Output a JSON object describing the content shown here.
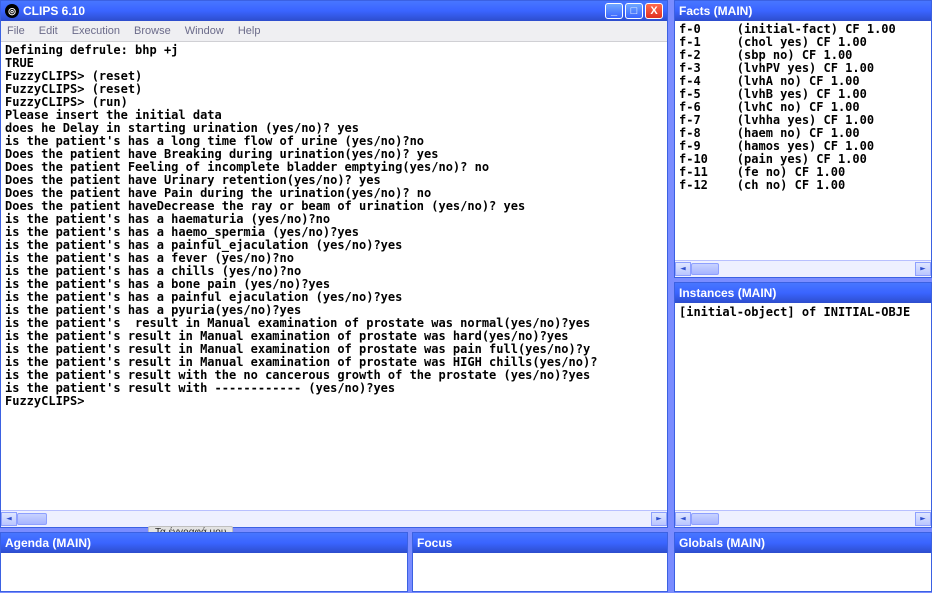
{
  "main": {
    "title": "CLIPS 6.10",
    "menu": [
      "File",
      "Edit",
      "Execution",
      "Browse",
      "Window",
      "Help"
    ],
    "terminal_lines": [
      "Defining defrule: bhp +j",
      "TRUE",
      "FuzzyCLIPS> (reset)",
      "FuzzyCLIPS> (reset)",
      "FuzzyCLIPS> (run)",
      "Please insert the initial data",
      "does he Delay in starting urination (yes/no)? yes",
      "is the patient's has a long time flow of urine (yes/no)?no",
      "Does the patient have Breaking during urination(yes/no)? yes",
      "Does the patient Feeling of incomplete bladder emptying(yes/no)? no",
      "Does the patient have Urinary retention(yes/no)? yes",
      "Does the patient have Pain during the urination(yes/no)? no",
      "Does the patient haveDecrease the ray or beam of urination (yes/no)? yes",
      "is the patient's has a haematuria (yes/no)?no",
      "is the patient's has a haemo_spermia (yes/no)?yes",
      "is the patient's has a painful_ejaculation (yes/no)?yes",
      "is the patient's has a fever (yes/no)?no",
      "is the patient's has a chills (yes/no)?no",
      "is the patient's has a bone pain (yes/no)?yes",
      "is the patient's has a painful ejaculation (yes/no)?yes",
      "is the patient's has a pyuria(yes/no)?yes",
      "is the patient's  result in Manual examination of prostate was normal(yes/no)?yes",
      "is the patient's result in Manual examination of prostate was hard(yes/no)?yes",
      "is the patient's result in Manual examination of prostate was pain full(yes/no)?y",
      "is the patient's result in Manual examination of prostate was HIGH chills(yes/no)?",
      "is the patient's result with the no cancerous growth of the prostate (yes/no)?yes",
      "is the patient's result with ------------ (yes/no)?yes",
      "FuzzyCLIPS>"
    ]
  },
  "facts": {
    "title": "Facts (MAIN)",
    "rows": [
      {
        "id": "f-0",
        "fact": "(initial-fact) CF 1.00"
      },
      {
        "id": "f-1",
        "fact": "(chol yes) CF 1.00"
      },
      {
        "id": "f-2",
        "fact": "(sbp no) CF 1.00"
      },
      {
        "id": "f-3",
        "fact": "(lvhPV yes) CF 1.00"
      },
      {
        "id": "f-4",
        "fact": "(lvhA no) CF 1.00"
      },
      {
        "id": "f-5",
        "fact": "(lvhB yes) CF 1.00"
      },
      {
        "id": "f-6",
        "fact": "(lvhC no) CF 1.00"
      },
      {
        "id": "f-7",
        "fact": "(lvhha yes) CF 1.00"
      },
      {
        "id": "f-8",
        "fact": "(haem no) CF 1.00"
      },
      {
        "id": "f-9",
        "fact": "(hamos yes) CF 1.00"
      },
      {
        "id": "f-10",
        "fact": "(pain yes) CF 1.00"
      },
      {
        "id": "f-11",
        "fact": "(fe no) CF 1.00"
      },
      {
        "id": "f-12",
        "fact": "(ch no) CF 1.00"
      }
    ]
  },
  "instances": {
    "title": "Instances (MAIN)",
    "text": "[initial-object] of INITIAL-OBJE"
  },
  "agenda": {
    "title": "Agenda (MAIN)"
  },
  "focus": {
    "title": "Focus"
  },
  "globals": {
    "title": "Globals (MAIN)"
  },
  "taskbar_fragment": "Τα έγγραφά μου",
  "glyphs": {
    "min": "_",
    "max": "□",
    "close": "X",
    "left": "◄",
    "right": "►"
  }
}
